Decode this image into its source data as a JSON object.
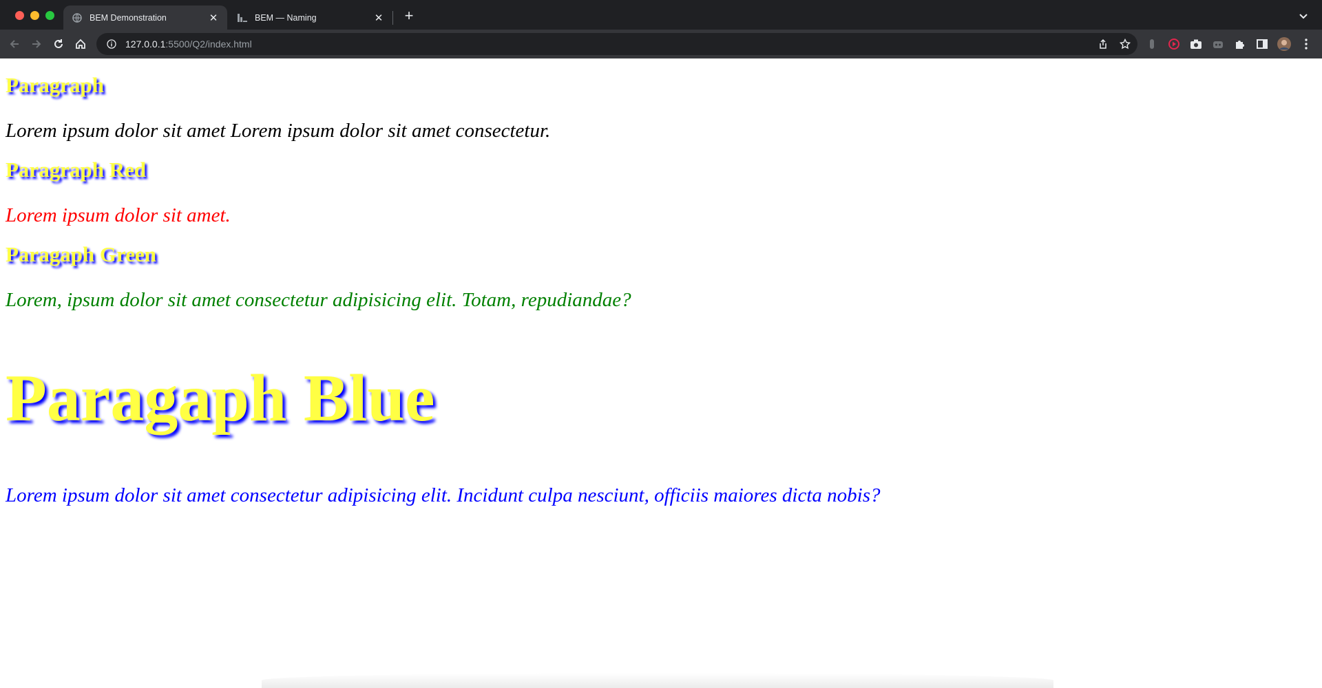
{
  "browser": {
    "tabs": [
      {
        "title": "BEM Demonstration",
        "active": true,
        "favicon": "globe-icon"
      },
      {
        "title": "BEM — Naming",
        "active": false,
        "favicon": "page-icon"
      }
    ],
    "new_tab_label": "+",
    "url": {
      "host": "127.0.0.1",
      "rest": ":5500/Q2/index.html"
    }
  },
  "page": {
    "sections": [
      {
        "heading": "Paragraph",
        "text": "Lorem ipsum dolor sit amet Lorem ipsum dolor sit amet consectetur."
      },
      {
        "heading": "Paragraph Red",
        "text": "Lorem ipsum dolor sit amet."
      },
      {
        "heading": "Paragaph Green",
        "text": "Lorem, ipsum dolor sit amet consectetur adipisicing elit. Totam, repudiandae?"
      },
      {
        "heading": "Paragaph Blue",
        "text": "Lorem ipsum dolor sit amet consectetur adipisicing elit. Incidunt culpa nesciunt, officiis maiores dicta nobis?"
      }
    ]
  },
  "colors": {
    "heading": "#ffff44",
    "heading_shadow": "#0000ff",
    "red": "#ff0000",
    "green": "#008000",
    "blue": "#0000ff",
    "chrome_dark": "#1f2023",
    "chrome_toolbar": "#35363a"
  }
}
